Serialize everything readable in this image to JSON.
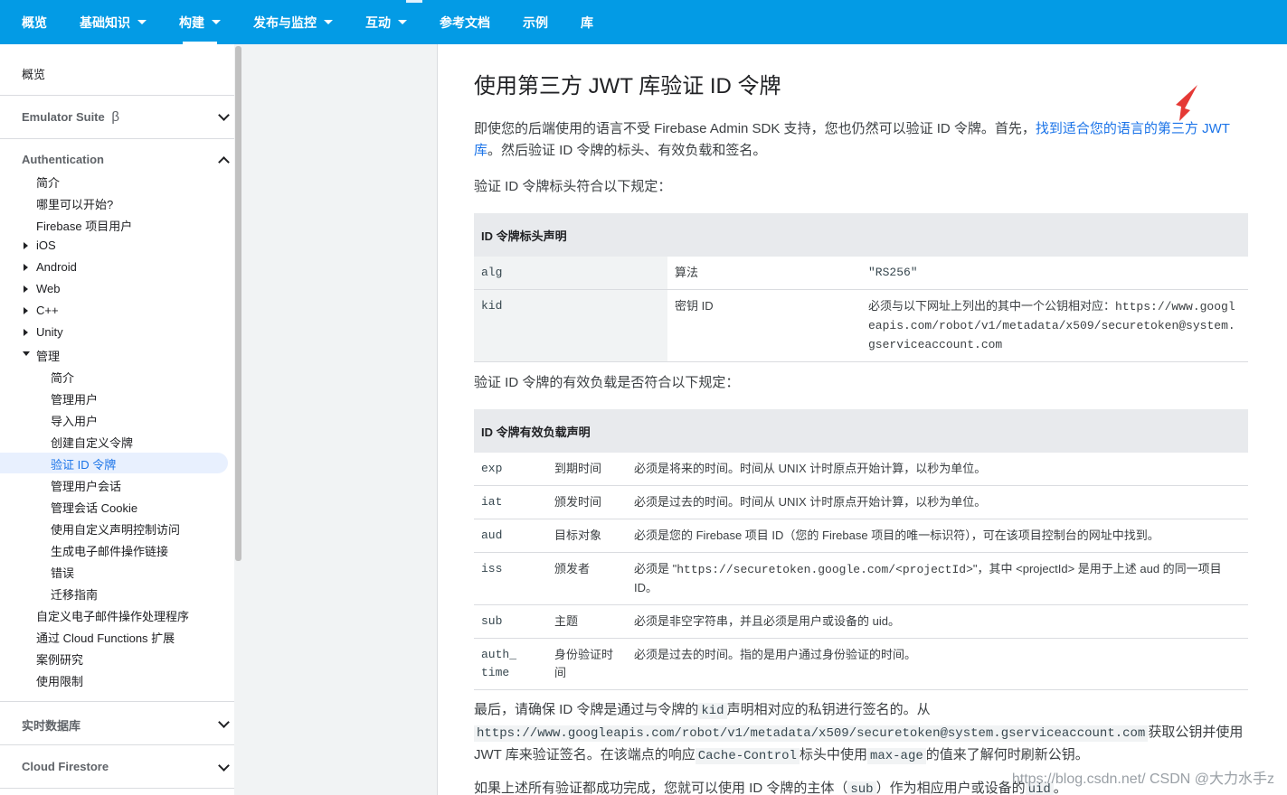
{
  "topnav": {
    "items": [
      {
        "label": "概览",
        "caret": false
      },
      {
        "label": "基础知识",
        "caret": true
      },
      {
        "label": "构建",
        "caret": true,
        "active": true
      },
      {
        "label": "发布与监控",
        "caret": true
      },
      {
        "label": "互动",
        "caret": true
      },
      {
        "label": "参考文档",
        "caret": false
      },
      {
        "label": "示例",
        "caret": false
      },
      {
        "label": "库",
        "caret": false
      }
    ],
    "accent": "#039be5"
  },
  "sidebar": {
    "overview": "概览",
    "emulator": "Emulator Suite",
    "emulator_beta": "β",
    "auth_head": "Authentication",
    "auth_items": [
      "简介",
      "哪里可以开始?",
      "Firebase 项目用户",
      "iOS",
      "Android",
      "Web",
      "C++",
      "Unity",
      "管理"
    ],
    "admin_items": [
      "简介",
      "管理用户",
      "导入用户",
      "创建自定义令牌",
      "验证 ID 令牌",
      "管理用户会话",
      "管理会话 Cookie",
      "使用自定义声明控制访问",
      "生成电子邮件操作链接",
      "错误",
      "迁移指南"
    ],
    "after_items": [
      "自定义电子邮件操作处理程序",
      "通过 Cloud Functions 扩展",
      "案例研究",
      "使用限制"
    ],
    "realtime_db": "实时数据库",
    "firestore": "Cloud Firestore"
  },
  "main": {
    "title": "使用第三方 JWT 库验证 ID 令牌",
    "intro_before": "即使您的后端使用的语言不受 Firebase Admin SDK 支持，您也仍然可以验证 ID 令牌。首先，",
    "intro_link": "找到适合您的语言的第三方 JWT 库",
    "intro_after": "。然后验证 ID 令牌的标头、有效负载和签名。",
    "header_intro": "验证 ID 令牌标头符合以下规定：",
    "header_table": {
      "title": "ID 令牌标头声明",
      "rows": [
        {
          "key": "alg",
          "name": "算法",
          "desc": "\"RS256\""
        },
        {
          "key": "kid",
          "name": "密钥 ID",
          "desc_prefix": "必须与以下网址上列出的其中一个公钥相对应：",
          "desc_code": "https://www.googleapis.com/robot/v1/metadata/x509/securetoken@system.gserviceaccount.com"
        }
      ]
    },
    "payload_intro": "验证 ID 令牌的有效负载是否符合以下规定：",
    "payload_table": {
      "title": "ID 令牌有效负载声明",
      "rows": [
        {
          "key": "exp",
          "name": "到期时间",
          "desc": "必须是将来的时间。时间从 UNIX 计时原点开始计算，以秒为单位。"
        },
        {
          "key": "iat",
          "name": "颁发时间",
          "desc": "必须是过去的时间。时间从 UNIX 计时原点开始计算，以秒为单位。"
        },
        {
          "key": "aud",
          "name": "目标对象",
          "desc": "必须是您的 Firebase 项目 ID（您的 Firebase 项目的唯一标识符），可在该项目控制台的网址中找到。"
        },
        {
          "key": "iss",
          "name": "颁发者",
          "desc_a": "必须是 \"",
          "desc_code": "https://securetoken.google.com/<projectId>",
          "desc_b": "\"，其中 <projectId> 是用于上述 aud 的同一项目 ID。"
        },
        {
          "key": "sub",
          "name": "主题",
          "desc": "必须是非空字符串，并且必须是用户或设备的 uid。"
        },
        {
          "key": "auth_time",
          "key_wrap": "auth_\ntime",
          "name": "身份验证时间",
          "desc": "必须是过去的时间。指的是用户通过身份验证的时间。"
        }
      ]
    },
    "final_a": "最后，请确保 ID 令牌是通过与令牌的",
    "final_kid": "kid",
    "final_b": "声明相对应的私钥进行签名的。从",
    "final_url": "https://www.googleapis.com/robot/v1/metadata/x509/securetoken@system.gserviceaccount.com",
    "final_c": "获取公钥并使用 JWT 库来验证签名。在该端点的响应",
    "final_cc": "Cache-Control",
    "final_d": "标头中使用",
    "final_maxage": "max-age",
    "final_e": "的值来了解何时刷新公钥。",
    "last_a": "如果上述所有验证都成功完成，您就可以使用 ID 令牌的主体（",
    "last_sub": "sub",
    "last_b": "）作为相应用户或设备的",
    "last_uid": "uid",
    "last_c": "。"
  },
  "watermark": "https://blog.csdn.net/  CSDN @大力水手z",
  "colors": {
    "link": "#1a73e8",
    "arrow": "#e53935"
  }
}
